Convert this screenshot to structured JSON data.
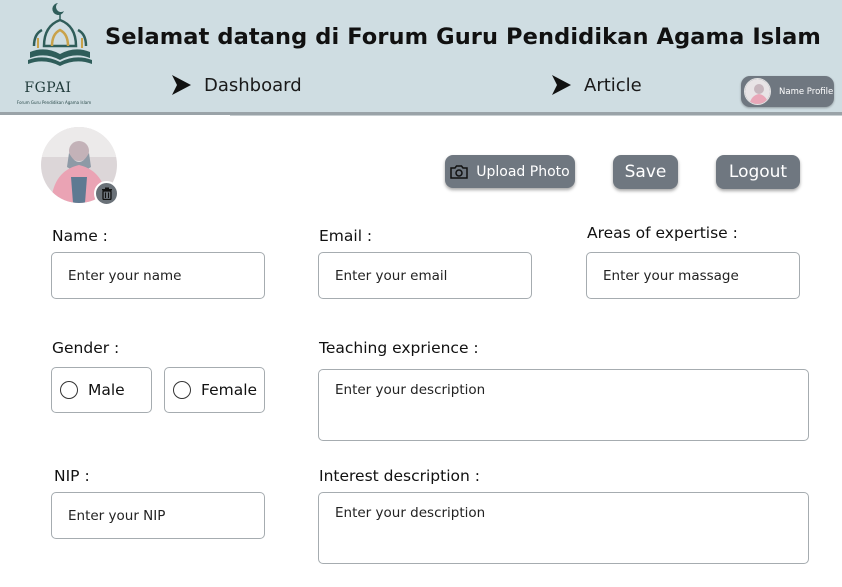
{
  "header": {
    "logo_title": "FGPAI",
    "logo_subtitle": "Forum Guru Pendidikan Agama Islam",
    "welcome": "Selamat datang di Forum Guru Pendidikan Agama Islam",
    "nav": {
      "dashboard": "Dashboard",
      "article": "Article"
    },
    "profile_name": "Name Profile"
  },
  "actions": {
    "upload_photo": "Upload Photo",
    "save": "Save",
    "logout": "Logout"
  },
  "form": {
    "name": {
      "label": "Name :",
      "placeholder": "Enter your name"
    },
    "email": {
      "label": "Email :",
      "placeholder": "Enter your email"
    },
    "expertise": {
      "label": "Areas of expertise :",
      "placeholder": "Enter your massage"
    },
    "gender": {
      "label": "Gender :",
      "options": [
        "Male",
        "Female"
      ]
    },
    "teaching": {
      "label": "Teaching exprience :",
      "placeholder": "Enter your description"
    },
    "nip": {
      "label": "NIP :",
      "placeholder": "Enter your NIP"
    },
    "interest": {
      "label": "Interest description :",
      "placeholder": "Enter your description"
    }
  },
  "colors": {
    "header_bg": "#cfdde2",
    "button_bg": "#6f7780",
    "logo_teal": "#2f5d5a",
    "logo_gold": "#c9a24a"
  },
  "icons": {
    "nav_arrow": "arrow-right-icon",
    "upload": "camera-icon",
    "delete_avatar": "trash-icon"
  }
}
